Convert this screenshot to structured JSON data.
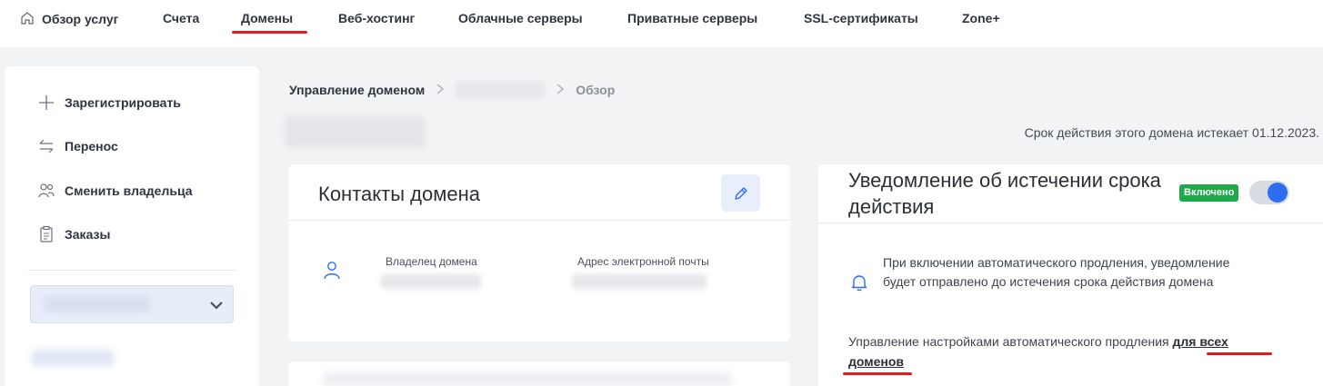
{
  "nav": {
    "items": [
      {
        "label": "Обзор услуг",
        "icon": "home-icon"
      },
      {
        "label": "Счета"
      },
      {
        "label": "Домены",
        "active": true
      },
      {
        "label": "Веб-хостинг"
      },
      {
        "label": "Облачные серверы"
      },
      {
        "label": "Приватные серверы"
      },
      {
        "label": "SSL-сертификаты"
      },
      {
        "label": "Zone+"
      }
    ]
  },
  "sidebar": {
    "items": [
      {
        "label": "Зарегистрировать",
        "icon": "plus-icon"
      },
      {
        "label": "Перенос",
        "icon": "transfer-arrows-icon"
      },
      {
        "label": "Сменить владельца",
        "icon": "users-icon"
      },
      {
        "label": "Заказы",
        "icon": "clipboard-icon"
      }
    ]
  },
  "breadcrumb": {
    "root": "Управление доменом",
    "current": "Обзор"
  },
  "expiry_text": "Срок действия этого домена истекает 01.12.2023.",
  "contacts": {
    "title": "Контакты домена",
    "owner_label": "Владелец домена",
    "email_label": "Адрес электронной почты"
  },
  "notification": {
    "title": "Уведомление об истечении срока действия",
    "badge": "Включено",
    "toggle_on": true,
    "info": "При включении автоматического продления, уведомление будет отправлено до истечения срока действия домена",
    "manage_text": "Управление настройками автоматического продления ",
    "manage_link": "для всех доменов"
  },
  "colors": {
    "accent": "#2f6df0",
    "badge": "#1faa4a",
    "highlight": "#e01b1b"
  }
}
